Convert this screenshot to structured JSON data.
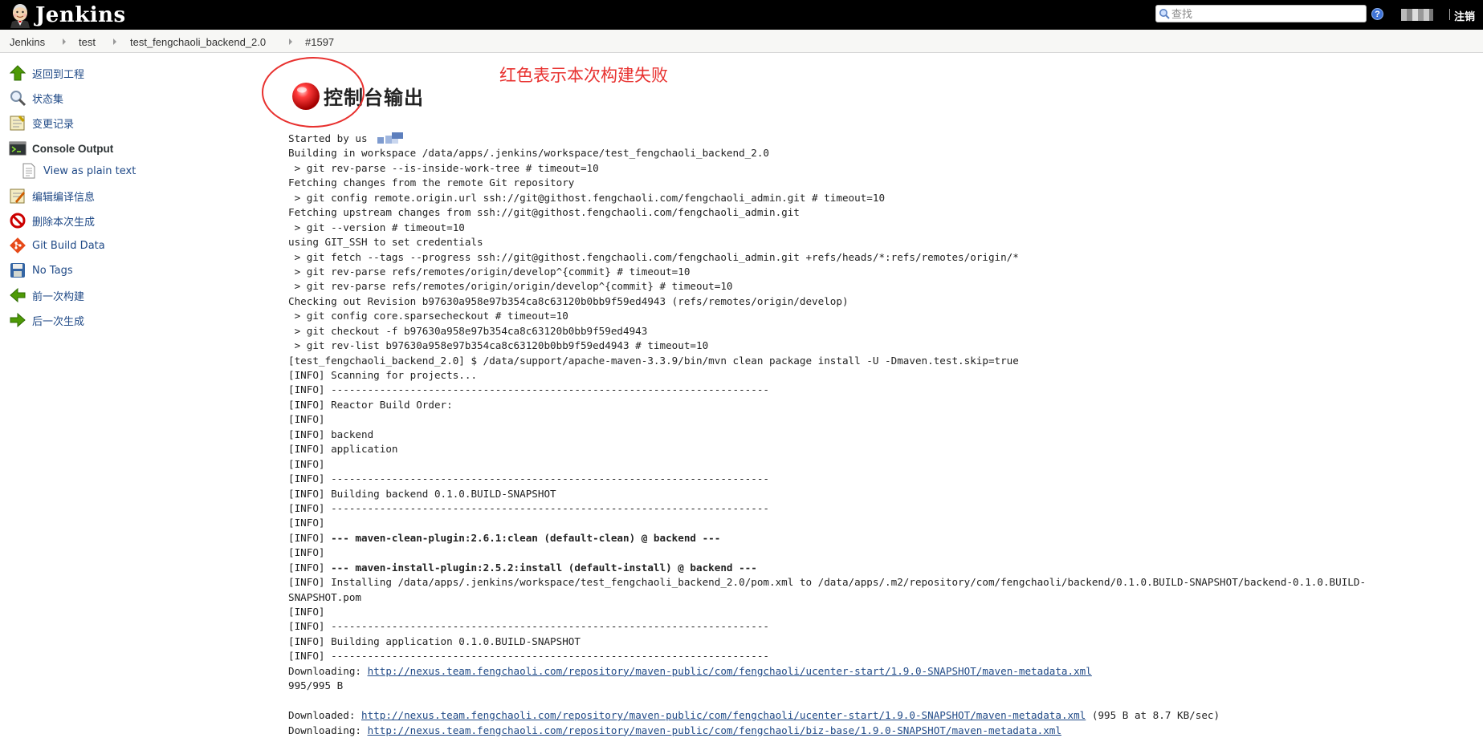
{
  "header": {
    "logo_text": "Jenkins",
    "search_placeholder": "查找",
    "help_label": "?",
    "logout_label": "注销"
  },
  "breadcrumbs": [
    "Jenkins",
    "test",
    "test_fengchaoli_backend_2.0",
    "#1597"
  ],
  "sidebar": {
    "items": [
      {
        "label": "返回到工程",
        "icon": "up-arrow-icon"
      },
      {
        "label": "状态集",
        "icon": "magnifier-icon"
      },
      {
        "label": "变更记录",
        "icon": "notepad-icon"
      },
      {
        "label": "Console Output",
        "icon": "terminal-icon",
        "active": true
      },
      {
        "label": "View as plain text",
        "icon": "document-icon"
      },
      {
        "label": "编辑编译信息",
        "icon": "notepad-edit-icon"
      },
      {
        "label": "删除本次生成",
        "icon": "no-entry-icon"
      },
      {
        "label": "Git Build Data",
        "icon": "git-icon"
      },
      {
        "label": "No Tags",
        "icon": "save-disk-icon"
      },
      {
        "label": "前一次构建",
        "icon": "left-arrow-icon"
      },
      {
        "label": "后一次生成",
        "icon": "right-arrow-icon"
      }
    ]
  },
  "main": {
    "title": "控制台输出",
    "annotation": "红色表示本次构建失败",
    "console_lines": [
      {
        "text": "Started by us"
      },
      {
        "text": "Building in workspace /data/apps/.jenkins/workspace/test_fengchaoli_backend_2.0"
      },
      {
        "text": " > git rev-parse --is-inside-work-tree # timeout=10"
      },
      {
        "text": "Fetching changes from the remote Git repository"
      },
      {
        "text": " > git config remote.origin.url ssh://git@githost.fengchaoli.com/fengchaoli_admin.git # timeout=10"
      },
      {
        "text": "Fetching upstream changes from ssh://git@githost.fengchaoli.com/fengchaoli_admin.git"
      },
      {
        "text": " > git --version # timeout=10"
      },
      {
        "text": "using GIT_SSH to set credentials"
      },
      {
        "text": " > git fetch --tags --progress ssh://git@githost.fengchaoli.com/fengchaoli_admin.git +refs/heads/*:refs/remotes/origin/*"
      },
      {
        "text": " > git rev-parse refs/remotes/origin/develop^{commit} # timeout=10"
      },
      {
        "text": " > git rev-parse refs/remotes/origin/origin/develop^{commit} # timeout=10"
      },
      {
        "text": "Checking out Revision b97630a958e97b354ca8c63120b0bb9f59ed4943 (refs/remotes/origin/develop)"
      },
      {
        "text": " > git config core.sparsecheckout # timeout=10"
      },
      {
        "text": " > git checkout -f b97630a958e97b354ca8c63120b0bb9f59ed4943"
      },
      {
        "text": " > git rev-list b97630a958e97b354ca8c63120b0bb9f59ed4943 # timeout=10"
      },
      {
        "text": "[test_fengchaoli_backend_2.0] $ /data/support/apache-maven-3.3.9/bin/mvn clean package install -U -Dmaven.test.skip=true"
      },
      {
        "text": "[INFO] Scanning for projects..."
      },
      {
        "text": "[INFO] ------------------------------------------------------------------------"
      },
      {
        "text": "[INFO] Reactor Build Order:"
      },
      {
        "text": "[INFO]"
      },
      {
        "text": "[INFO] backend"
      },
      {
        "text": "[INFO] application"
      },
      {
        "text": "[INFO]"
      },
      {
        "text": "[INFO] ------------------------------------------------------------------------"
      },
      {
        "text": "[INFO] Building backend 0.1.0.BUILD-SNAPSHOT"
      },
      {
        "text": "[INFO] ------------------------------------------------------------------------"
      },
      {
        "text": "[INFO]"
      },
      {
        "prefix": "[INFO] ",
        "bold": "--- maven-clean-plugin:2.6.1:clean (default-clean) @ backend ---"
      },
      {
        "text": "[INFO]"
      },
      {
        "prefix": "[INFO] ",
        "bold": "--- maven-install-plugin:2.5.2:install (default-install) @ backend ---"
      },
      {
        "text": "[INFO] Installing /data/apps/.jenkins/workspace/test_fengchaoli_backend_2.0/pom.xml to /data/apps/.m2/repository/com/fengchaoli/backend/0.1.0.BUILD-SNAPSHOT/backend-0.1.0.BUILD-"
      },
      {
        "text": "SNAPSHOT.pom"
      },
      {
        "text": "[INFO]"
      },
      {
        "text": "[INFO] ------------------------------------------------------------------------"
      },
      {
        "text": "[INFO] Building application 0.1.0.BUILD-SNAPSHOT"
      },
      {
        "text": "[INFO] ------------------------------------------------------------------------"
      },
      {
        "prefix": "Downloading: ",
        "link": "http://nexus.team.fengchaoli.com/repository/maven-public/com/fengchaoli/ucenter-start/1.9.0-SNAPSHOT/maven-metadata.xml"
      },
      {
        "text": "995/995 B"
      },
      {
        "text": ""
      },
      {
        "prefix": "Downloaded: ",
        "link": "http://nexus.team.fengchaoli.com/repository/maven-public/com/fengchaoli/ucenter-start/1.9.0-SNAPSHOT/maven-metadata.xml",
        "suffix": " (995 B at 8.7 KB/sec)"
      },
      {
        "prefix": "Downloading: ",
        "link": "http://nexus.team.fengchaoli.com/repository/maven-public/com/fengchaoli/biz-base/1.9.0-SNAPSHOT/maven-metadata.xml"
      }
    ]
  },
  "colors": {
    "header_bg": "#000000",
    "link": "#204a87",
    "annotation": "#e8312f",
    "failed_ball": "#d60000"
  }
}
